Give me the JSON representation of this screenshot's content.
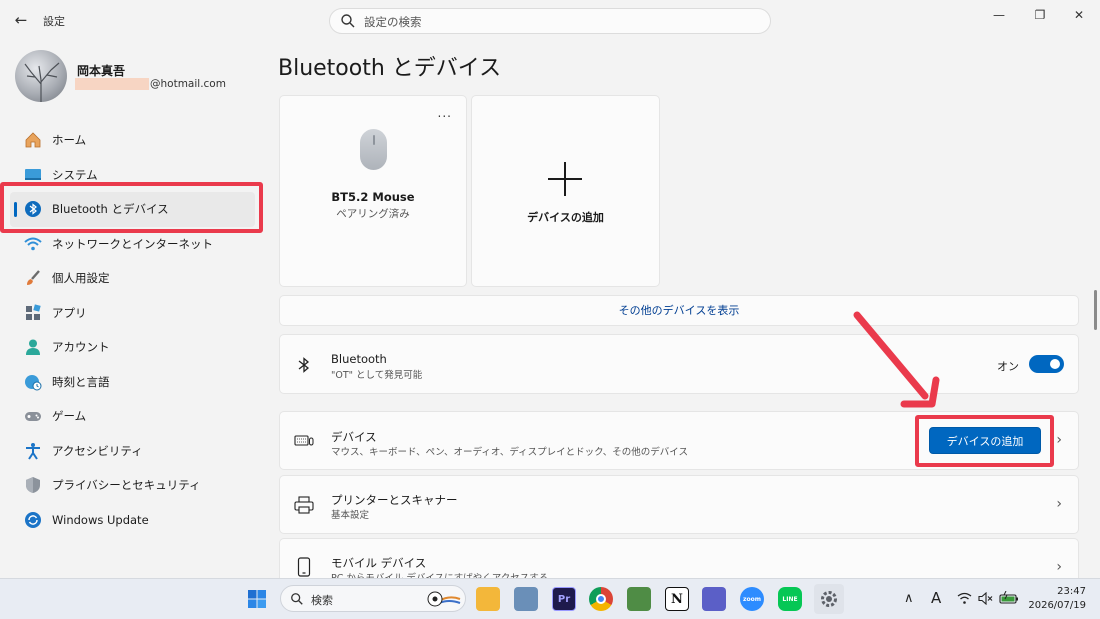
{
  "window": {
    "app_title": "設定",
    "back_glyph": "←",
    "search_placeholder": "設定の検索",
    "minimize_glyph": "—",
    "maximize_glyph": "❐",
    "close_glyph": "✕"
  },
  "profile": {
    "name": "岡本真吾",
    "email_suffix": "@hotmail.com"
  },
  "sidebar": {
    "items": [
      {
        "label": "ホーム",
        "icon": "home-icon",
        "active": false
      },
      {
        "label": "システム",
        "icon": "system-icon",
        "active": false
      },
      {
        "label": "Bluetooth とデバイス",
        "icon": "bluetooth-icon",
        "active": true
      },
      {
        "label": "ネットワークとインターネット",
        "icon": "network-icon",
        "active": false
      },
      {
        "label": "個人用設定",
        "icon": "brush-icon",
        "active": false
      },
      {
        "label": "アプリ",
        "icon": "apps-icon",
        "active": false
      },
      {
        "label": "アカウント",
        "icon": "account-icon",
        "active": false
      },
      {
        "label": "時刻と言語",
        "icon": "globe-clock-icon",
        "active": false
      },
      {
        "label": "ゲーム",
        "icon": "gamepad-icon",
        "active": false
      },
      {
        "label": "アクセシビリティ",
        "icon": "accessibility-icon",
        "active": false
      },
      {
        "label": "プライバシーとセキュリティ",
        "icon": "shield-icon",
        "active": false
      },
      {
        "label": "Windows Update",
        "icon": "update-icon",
        "active": false
      }
    ]
  },
  "main": {
    "title": "Bluetooth とデバイス",
    "device_card": {
      "name": "BT5.2 Mouse",
      "status": "ペアリング済み",
      "more_glyph": "..."
    },
    "add_card_label": "デバイスの追加",
    "more_devices_label": "その他のデバイスを表示",
    "bluetooth_row": {
      "title": "Bluetooth",
      "subtitle": "\"OT\" として発見可能",
      "toggle_label": "オン",
      "toggle_on": true
    },
    "devices_row": {
      "title": "デバイス",
      "subtitle": "マウス、キーボード、ペン、オーディオ、ディスプレイとドック、その他のデバイス",
      "button_label": "デバイスの追加"
    },
    "printers_row": {
      "title": "プリンターとスキャナー",
      "subtitle": "基本設定"
    },
    "mobile_row": {
      "title": "モバイル デバイス",
      "subtitle": "PC からモバイル デバイスにすばやくアクセスする"
    },
    "chevron_glyph": "›"
  },
  "taskbar": {
    "search_label": "検索",
    "apps": [
      {
        "icon": "windows-start-icon",
        "color": "#1f6fd1"
      },
      {
        "icon": "file-explorer-icon",
        "color": "#f3b73a"
      },
      {
        "icon": "photos-icon",
        "color": "#6a8fb8"
      },
      {
        "icon": "premiere-pro-icon",
        "color": "#1e1a4c",
        "text": "Pr"
      },
      {
        "icon": "chrome-icon",
        "color": "#db4437"
      },
      {
        "icon": "paint-icon",
        "color": "#4f8c45"
      },
      {
        "icon": "notion-icon",
        "color": "#ffffff",
        "text": "N"
      },
      {
        "icon": "teams-icon",
        "color": "#5b5fc7"
      },
      {
        "icon": "zoom-icon",
        "color": "#2d8cff",
        "text": "zoom"
      },
      {
        "icon": "line-icon",
        "color": "#06c755",
        "text": "LINE"
      },
      {
        "icon": "settings-icon",
        "color": "#6b6f76"
      }
    ],
    "tray": {
      "chevron": "∧",
      "ime": "A",
      "wifi": "wifi-icon",
      "volume": "volume-muted-icon",
      "battery": "battery-icon"
    },
    "clock": {
      "time": "23:47",
      "date": "2026/07/19"
    }
  },
  "colors": {
    "accent": "#0067c0",
    "highlight": "#ea3a4c"
  }
}
